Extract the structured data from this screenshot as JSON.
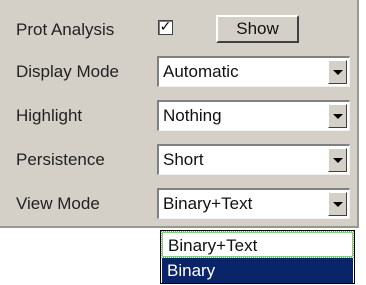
{
  "prot_analysis": {
    "label": "Prot Analysis",
    "checked": true,
    "check_glyph": "✓",
    "show_label": "Show"
  },
  "display_mode": {
    "label": "Display Mode",
    "value": "Automatic"
  },
  "highlight": {
    "label": "Highlight",
    "value": "Nothing"
  },
  "persistence": {
    "label": "Persistence",
    "value": "Short"
  },
  "view_mode": {
    "label": "View Mode",
    "value": "Binary+Text",
    "options": [
      "Binary+Text",
      "Binary"
    ],
    "highlighted_option": "Binary"
  }
}
